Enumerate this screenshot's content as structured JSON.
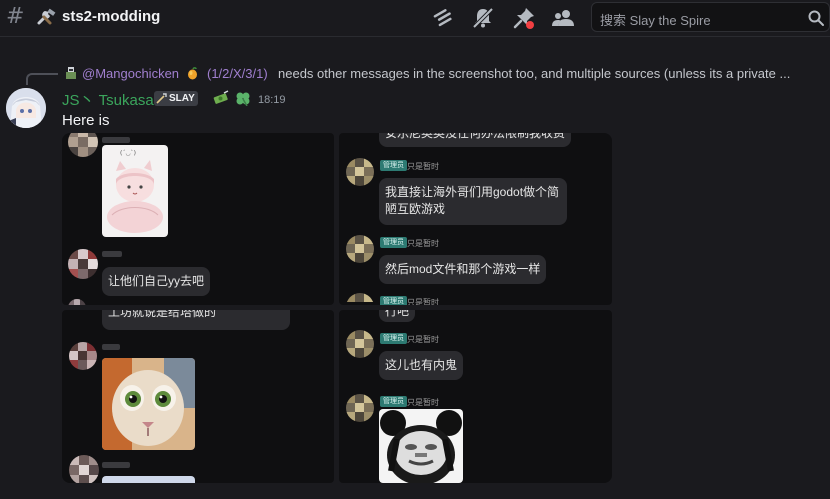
{
  "header": {
    "channel_title": "sts2-modding",
    "search_placeholder": "搜索 Slay the Spire",
    "colors": {
      "background": "#1a1a1e",
      "accent_green": "#3ba55c",
      "mention_purple": "#a07fcf",
      "unread_red": "#f23f42"
    }
  },
  "toolbar": {
    "icons": [
      "threads-icon",
      "mute-bell-icon",
      "pinned-icon",
      "members-icon"
    ]
  },
  "reply": {
    "mention": "@Mangochicken",
    "tags": "(1/2/X/3/1)",
    "text": "needs other messages in the screenshot too, and multiple sources (unless its a private ..."
  },
  "message": {
    "author": "JS丶 Tsukasa",
    "badge": "SLAY",
    "timestamp": "18:19",
    "text": "Here is"
  },
  "screenshot": {
    "panel1": {
      "bubble1": "让他们自己yy去吧"
    },
    "panel2": {
      "top_bubble": "安乐尼奥奥没任何办法限制我收费",
      "role": "管理员",
      "user": "只是暂时",
      "bubble1": "我直接让海外哥们用godot做个简陋互欧游戏",
      "bubble2": "然后mod文件和那个游戏一样"
    },
    "panel3": {
      "top_bubble": "工坊就说是给塔做的"
    },
    "panel4": {
      "top_bubble": "行吧",
      "role": "管理员",
      "user": "只是暂时",
      "bubble1": "这儿也有内鬼"
    }
  }
}
